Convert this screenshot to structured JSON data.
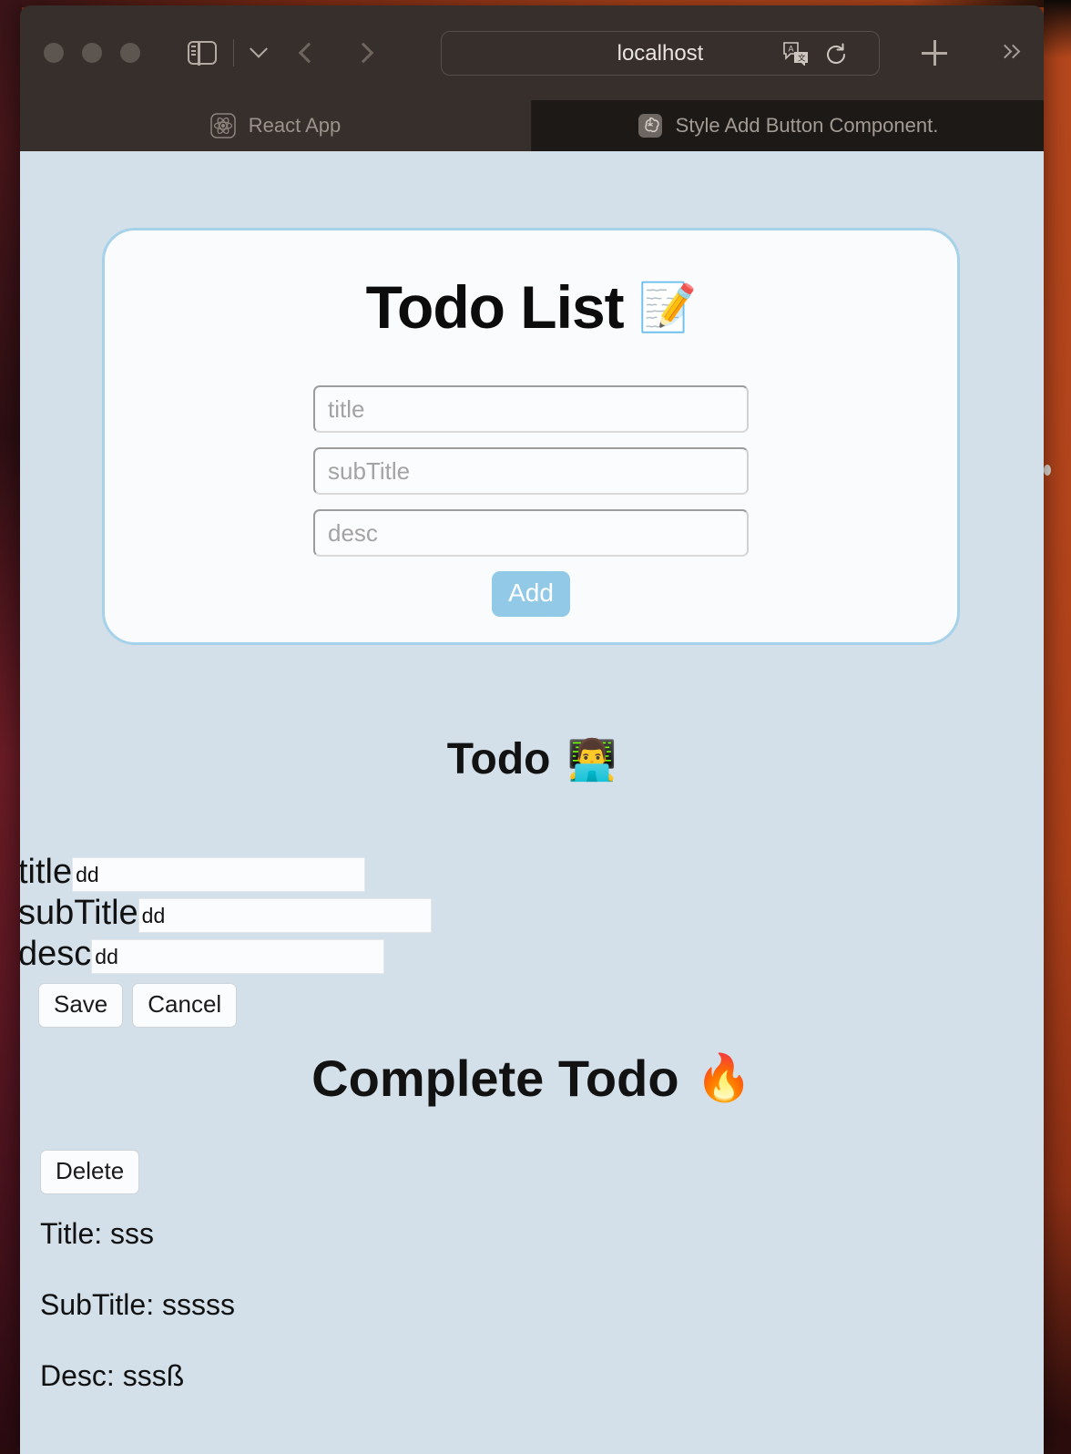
{
  "browser": {
    "address": "localhost",
    "icons": {
      "sidebar": "sidebar-toggle-icon",
      "chevron": "chevron-down-icon",
      "back": "back-arrow-icon",
      "forward": "forward-arrow-icon",
      "translate": "translate-icon",
      "reload": "reload-icon",
      "new_tab": "plus-icon",
      "overflow": "chevron-double-right-icon"
    },
    "tabs": [
      {
        "label": "React App",
        "favicon": "react-logo-icon",
        "active": false
      },
      {
        "label": "Style Add Button Component.",
        "favicon": "chatgpt-logo-icon",
        "active": true
      }
    ]
  },
  "page": {
    "card": {
      "title": "Todo List",
      "title_emoji": "📝",
      "inputs": [
        {
          "name": "title",
          "placeholder": "title",
          "value": ""
        },
        {
          "name": "subTitle",
          "placeholder": "subTitle",
          "value": ""
        },
        {
          "name": "desc",
          "placeholder": "desc",
          "value": ""
        }
      ],
      "add_label": "Add",
      "add_color": "#92c9e6"
    },
    "todo_section": {
      "heading": "Todo",
      "heading_emoji": "👨‍💻",
      "edit_form": {
        "labels": {
          "title": "title",
          "subtitle": "subTitle",
          "desc": "desc"
        },
        "values": {
          "title": "dd",
          "subtitle": "dd",
          "desc": "dd"
        },
        "save_label": "Save",
        "cancel_label": "Cancel"
      }
    },
    "complete_section": {
      "heading": "Complete Todo",
      "heading_emoji": "🔥",
      "delete_label": "Delete",
      "item": {
        "title": "Title: sss",
        "subtitle": "SubTitle: sssss",
        "desc": "Desc: sssß"
      }
    },
    "colors": {
      "page_bg": "#d3dfe9",
      "card_bg": "#fafbfd",
      "card_border": "#a6d2e9"
    }
  }
}
